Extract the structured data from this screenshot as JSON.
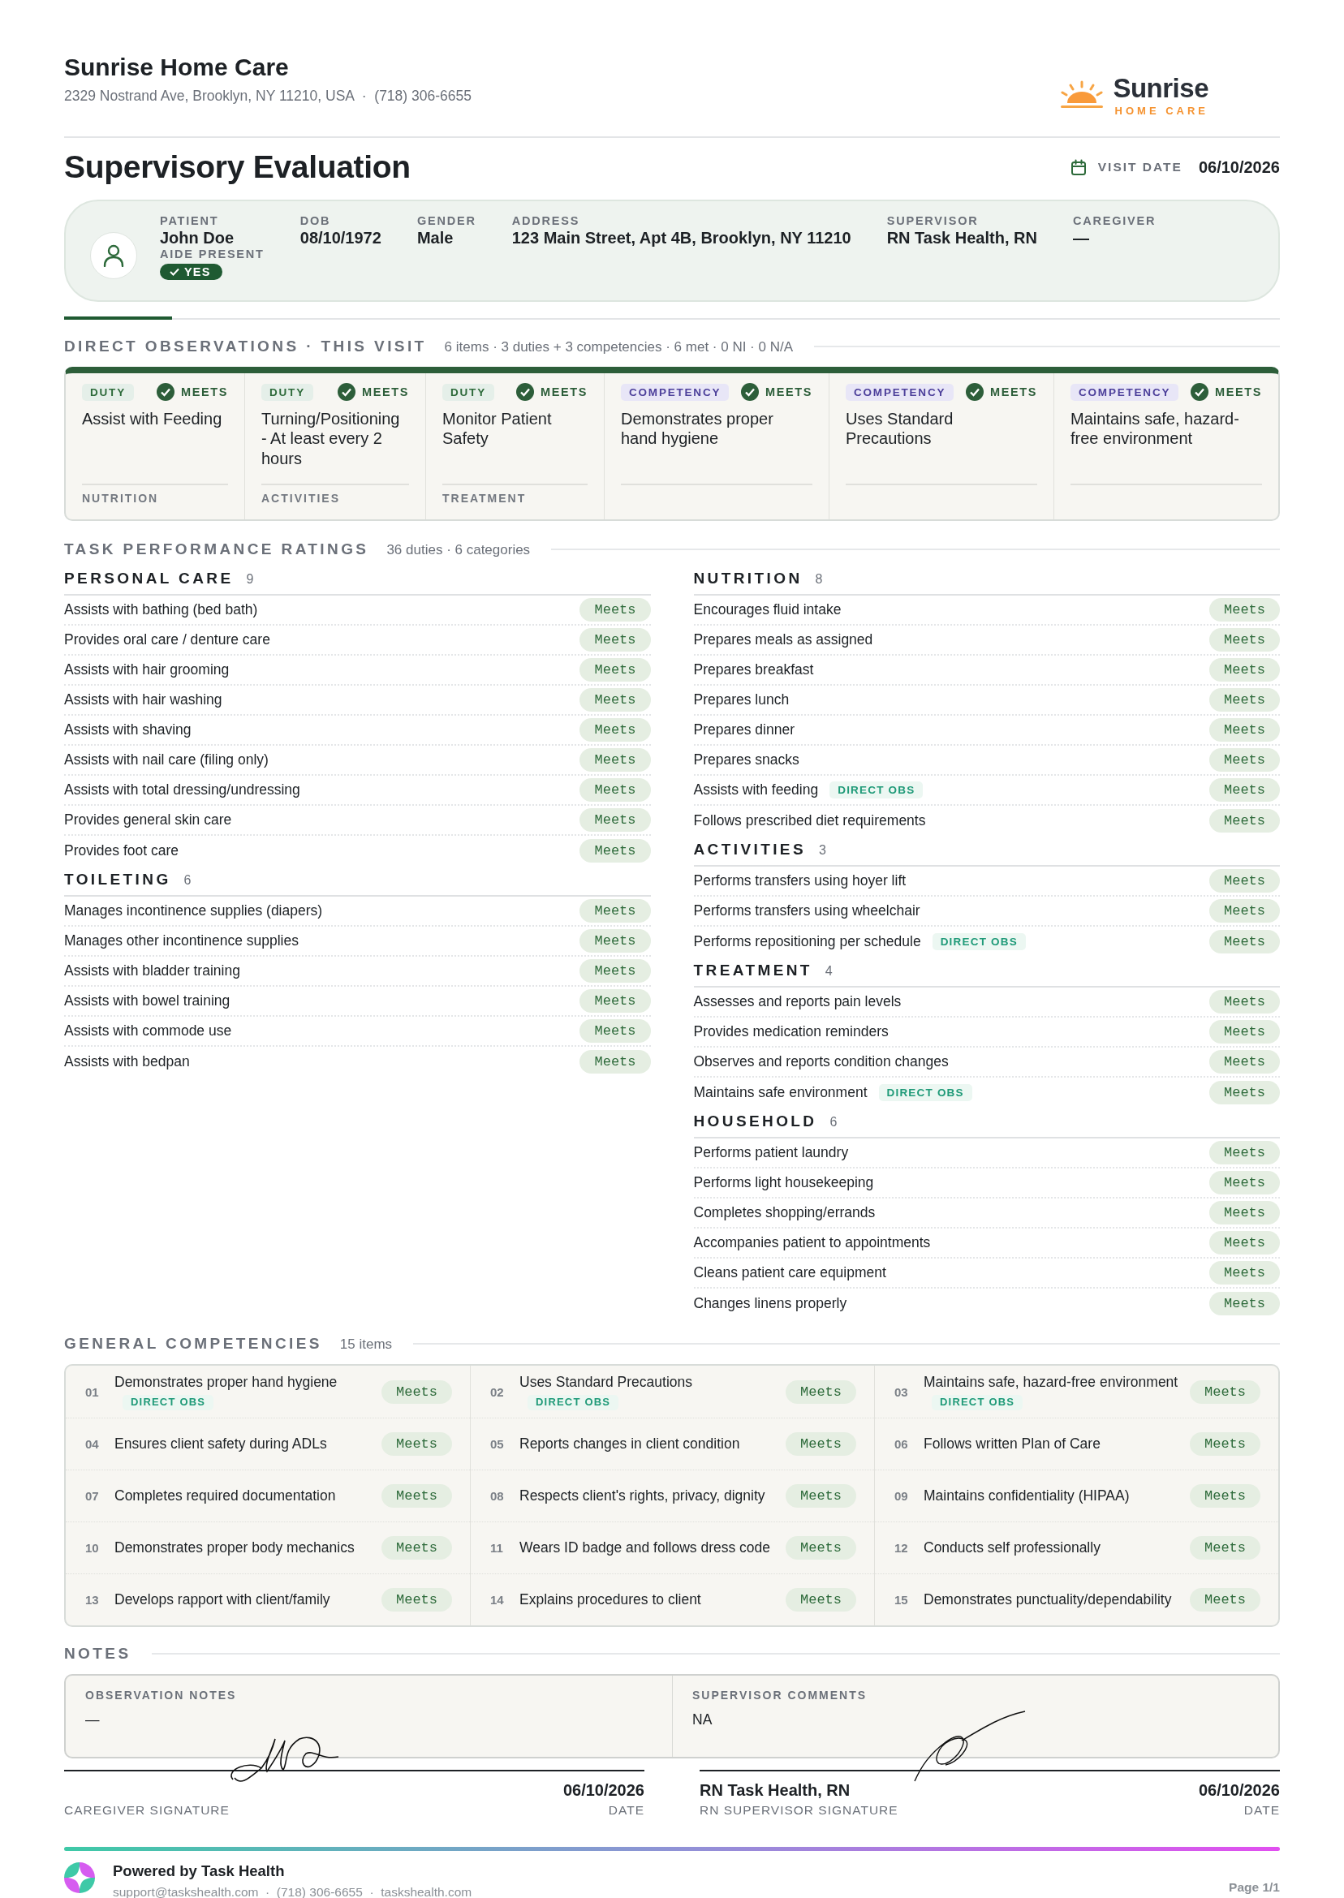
{
  "company": {
    "name": "Sunrise Home Care",
    "contact": "2329 Nostrand Ave, Brooklyn, NY 11210, USA  ·  (718) 306-6655"
  },
  "logo": {
    "name": "Sunrise",
    "tagline": "HOME CARE"
  },
  "title": "Supervisory Evaluation",
  "visit_date": {
    "label": "VISIT DATE",
    "value": "06/10/2026"
  },
  "patient_card": {
    "fields": [
      {
        "label": "PATIENT",
        "value": "John Doe"
      },
      {
        "label": "DOB",
        "value": "08/10/1972"
      },
      {
        "label": "GENDER",
        "value": "Male"
      },
      {
        "label": "ADDRESS",
        "value": "123 Main Street, Apt 4B, Brooklyn, NY 11210"
      },
      {
        "label": "SUPERVISOR",
        "value": "RN Task Health, RN"
      },
      {
        "label": "CAREGIVER",
        "value": "—"
      }
    ],
    "aide_present": {
      "label": "AIDE PRESENT",
      "value": "YES",
      "checked": true
    }
  },
  "direct_observations": {
    "title": "DIRECT OBSERVATIONS · THIS VISIT",
    "summary": "6 items · 3 duties + 3 competencies · 6 met · 0 NI · 0 N/A",
    "items": [
      {
        "kind": "duty",
        "type_label": "DUTY",
        "status": "MEETS",
        "met": true,
        "title": "Assist with Feeding",
        "category": "NUTRITION"
      },
      {
        "kind": "duty",
        "type_label": "DUTY",
        "status": "MEETS",
        "met": true,
        "title": "Turning/Positioning - At least every 2 hours",
        "category": "ACTIVITIES"
      },
      {
        "kind": "duty",
        "type_label": "DUTY",
        "status": "MEETS",
        "met": true,
        "title": "Monitor Patient Safety",
        "category": "TREATMENT"
      },
      {
        "kind": "competency",
        "type_label": "COMPETENCY",
        "status": "MEETS",
        "met": true,
        "title": "Demonstrates proper hand hygiene"
      },
      {
        "kind": "competency",
        "type_label": "COMPETENCY",
        "status": "MEETS",
        "met": true,
        "title": "Uses Standard Precautions"
      },
      {
        "kind": "competency",
        "type_label": "COMPETENCY",
        "status": "MEETS",
        "met": true,
        "title": "Maintains safe, hazard-free environment"
      }
    ]
  },
  "task_ratings": {
    "title": "TASK PERFORMANCE RATINGS",
    "summary": "36 duties · 6 categories",
    "columns": [
      [
        {
          "name": "PERSONAL CARE",
          "count": "9",
          "duties": [
            {
              "name": "Assists with bathing (bed bath)",
              "rating": "Meets"
            },
            {
              "name": "Provides oral care / denture care",
              "rating": "Meets"
            },
            {
              "name": "Assists with hair grooming",
              "rating": "Meets"
            },
            {
              "name": "Assists with hair washing",
              "rating": "Meets"
            },
            {
              "name": "Assists with shaving",
              "rating": "Meets"
            },
            {
              "name": "Assists with nail care (filing only)",
              "rating": "Meets"
            },
            {
              "name": "Assists with total dressing/undressing",
              "rating": "Meets"
            },
            {
              "name": "Provides general skin care",
              "rating": "Meets"
            },
            {
              "name": "Provides foot care",
              "rating": "Meets"
            }
          ]
        },
        {
          "name": "TOILETING",
          "count": "6",
          "duties": [
            {
              "name": "Manages incontinence supplies (diapers)",
              "rating": "Meets"
            },
            {
              "name": "Manages other incontinence supplies",
              "rating": "Meets"
            },
            {
              "name": "Assists with bladder training",
              "rating": "Meets"
            },
            {
              "name": "Assists with bowel training",
              "rating": "Meets"
            },
            {
              "name": "Assists with commode use",
              "rating": "Meets"
            },
            {
              "name": "Assists with bedpan",
              "rating": "Meets"
            }
          ]
        }
      ],
      [
        {
          "name": "NUTRITION",
          "count": "8",
          "duties": [
            {
              "name": "Encourages fluid intake",
              "rating": "Meets"
            },
            {
              "name": "Prepares meals as assigned",
              "rating": "Meets"
            },
            {
              "name": "Prepares breakfast",
              "rating": "Meets"
            },
            {
              "name": "Prepares lunch",
              "rating": "Meets"
            },
            {
              "name": "Prepares dinner",
              "rating": "Meets"
            },
            {
              "name": "Prepares snacks",
              "rating": "Meets"
            },
            {
              "name": "Assists with feeding",
              "tag": "DIRECT OBS",
              "rating": "Meets"
            },
            {
              "name": "Follows prescribed diet requirements",
              "rating": "Meets"
            }
          ]
        },
        {
          "name": "ACTIVITIES",
          "count": "3",
          "duties": [
            {
              "name": "Performs transfers using hoyer lift",
              "rating": "Meets"
            },
            {
              "name": "Performs transfers using wheelchair",
              "rating": "Meets"
            },
            {
              "name": "Performs repositioning per schedule",
              "tag": "DIRECT OBS",
              "rating": "Meets"
            }
          ]
        },
        {
          "name": "TREATMENT",
          "count": "4",
          "duties": [
            {
              "name": "Assesses and reports pain levels",
              "rating": "Meets"
            },
            {
              "name": "Provides medication reminders",
              "rating": "Meets"
            },
            {
              "name": "Observes and reports condition changes",
              "rating": "Meets"
            },
            {
              "name": "Maintains safe environment",
              "tag": "DIRECT OBS",
              "rating": "Meets"
            }
          ]
        },
        {
          "name": "HOUSEHOLD",
          "count": "6",
          "duties": [
            {
              "name": "Performs patient laundry",
              "rating": "Meets"
            },
            {
              "name": "Performs light housekeeping",
              "rating": "Meets"
            },
            {
              "name": "Completes shopping/errands",
              "rating": "Meets"
            },
            {
              "name": "Accompanies patient to appointments",
              "rating": "Meets"
            },
            {
              "name": "Cleans patient care equipment",
              "rating": "Meets"
            },
            {
              "name": "Changes linens properly",
              "rating": "Meets"
            }
          ]
        }
      ]
    ]
  },
  "general_competencies": {
    "title": "GENERAL COMPETENCIES",
    "summary": "15 items",
    "items": [
      {
        "number": "01",
        "name": "Demonstrates proper hand hygiene",
        "tag": "DIRECT OBS",
        "rating": "Meets"
      },
      {
        "number": "02",
        "name": "Uses Standard Precautions",
        "tag": "DIRECT OBS",
        "rating": "Meets"
      },
      {
        "number": "03",
        "name": "Maintains safe, hazard-free environment",
        "tag": "DIRECT OBS",
        "rating": "Meets"
      },
      {
        "number": "04",
        "name": "Ensures client safety during ADLs",
        "rating": "Meets"
      },
      {
        "number": "05",
        "name": "Reports changes in client condition",
        "rating": "Meets"
      },
      {
        "number": "06",
        "name": "Follows written Plan of Care",
        "rating": "Meets"
      },
      {
        "number": "07",
        "name": "Completes required documentation",
        "rating": "Meets"
      },
      {
        "number": "08",
        "name": "Respects client's rights, privacy, dignity",
        "rating": "Meets"
      },
      {
        "number": "09",
        "name": "Maintains confidentiality (HIPAA)",
        "rating": "Meets"
      },
      {
        "number": "10",
        "name": "Demonstrates proper body mechanics",
        "rating": "Meets"
      },
      {
        "number": "11",
        "name": "Wears ID badge and follows dress code",
        "rating": "Meets"
      },
      {
        "number": "12",
        "name": "Conducts self professionally",
        "rating": "Meets"
      },
      {
        "number": "13",
        "name": "Develops rapport with client/family",
        "rating": "Meets"
      },
      {
        "number": "14",
        "name": "Explains procedures to client",
        "rating": "Meets"
      },
      {
        "number": "15",
        "name": "Demonstrates punctuality/dependability",
        "rating": "Meets"
      }
    ]
  },
  "notes": {
    "title": "NOTES",
    "panels": [
      {
        "label": "OBSERVATION NOTES",
        "text": "—"
      },
      {
        "label": "SUPERVISOR COMMENTS",
        "text": "NA"
      }
    ]
  },
  "signatures": [
    {
      "label": "CAREGIVER SIGNATURE",
      "date": "06/10/2026",
      "date_label": "DATE"
    },
    {
      "name": "RN Task Health, RN",
      "label": "RN SUPERVISOR SIGNATURE",
      "date": "06/10/2026",
      "date_label": "DATE"
    }
  ],
  "footer": {
    "powered_by": "Powered by Task Health",
    "contact": "support@taskshealth.com  ·  (718) 306-6655  ·  taskshealth.com",
    "page": "Page 1/1"
  }
}
